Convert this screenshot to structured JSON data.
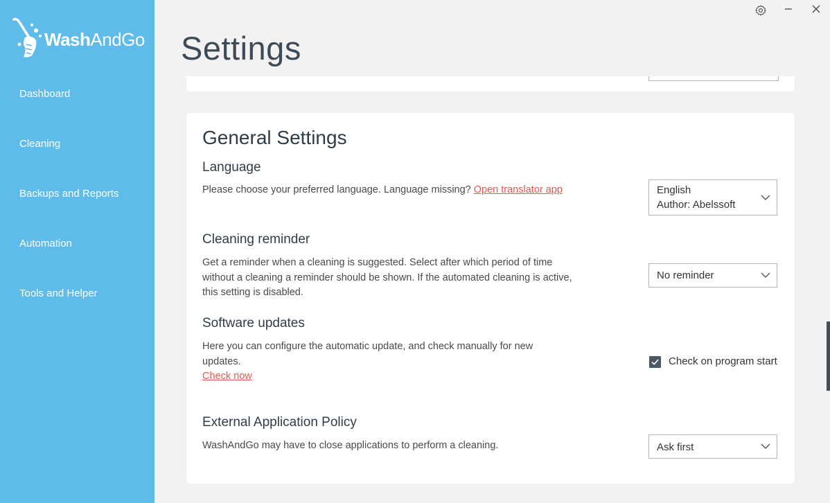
{
  "app": {
    "logo_text_bold": "Wash",
    "logo_text_rest": "AndGo",
    "logo_icon": "broom-icon"
  },
  "sidebar": {
    "items": [
      {
        "label": "Dashboard"
      },
      {
        "label": "Cleaning"
      },
      {
        "label": "Backups and Reports"
      },
      {
        "label": "Automation"
      },
      {
        "label": "Tools and Helper"
      }
    ]
  },
  "titlebar": {
    "settings_icon": "gear-icon",
    "minimize_icon": "minimize-icon",
    "close_icon": "close-icon"
  },
  "page": {
    "title": "Settings"
  },
  "general": {
    "title": "General Settings",
    "language": {
      "title": "Language",
      "desc": "Please choose your preferred language. Language missing?",
      "link": "Open translator app",
      "select_line1": "English",
      "select_line2": "Author: Abelssoft"
    },
    "reminder": {
      "title": "Cleaning reminder",
      "desc_line1": "Get a reminder when a cleaning is suggested. Select after which period of time",
      "desc_line2": "without a cleaning a reminder should be shown. If the automated cleaning is active,",
      "desc_line3": "this setting is disabled.",
      "select_value": "No reminder"
    },
    "updates": {
      "title": "Software updates",
      "desc_line1": "Here you can configure the automatic update, and check manually for new",
      "desc_line2": "updates.",
      "link": "Check now",
      "checkbox_label": "Check on program start",
      "checked": true
    },
    "policy": {
      "title": "External Application Policy",
      "desc": "WashAndGo may have to close applications to perform a cleaning.",
      "select_value": "Ask first"
    }
  },
  "colors": {
    "sidebar": "#5fbcea",
    "link": "#e05a4f",
    "checkbox": "#4a5866",
    "background": "#f2f2f2"
  }
}
